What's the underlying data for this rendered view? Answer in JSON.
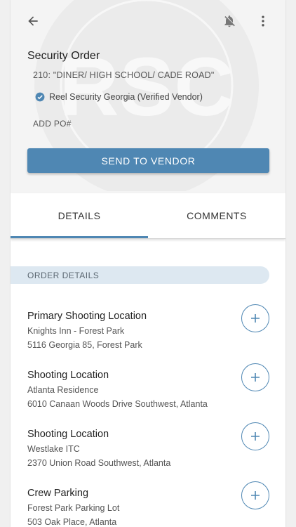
{
  "header": {
    "title": "Security Order",
    "subtitle": "210: \"DINER/ HIGH SCHOOL/ CADE ROAD\"",
    "vendor": "Reel Security Georgia (Verified Vendor)",
    "add_po": "ADD PO#",
    "send_button": "SEND TO VENDOR",
    "watermark_text": "RSC",
    "icons": {
      "back": "arrow-back-icon",
      "bell": "bell-off-icon",
      "more": "more-vertical-icon",
      "verified": "check-circle-icon"
    }
  },
  "tabs": [
    {
      "label": "DETAILS",
      "active": true
    },
    {
      "label": "COMMENTS",
      "active": false
    }
  ],
  "section": {
    "label": "ORDER DETAILS"
  },
  "locations": [
    {
      "name": "Primary Shooting Location",
      "place": "Knights Inn - Forest Park",
      "address": "5116 Georgia 85, Forest Park"
    },
    {
      "name": "Shooting Location",
      "place": "Atlanta Residence",
      "address": "6010 Canaan Woods Drive Southwest, Atlanta"
    },
    {
      "name": "Shooting Location",
      "place": "Westlake ITC",
      "address": "2370 Union Road Southwest, Atlanta"
    },
    {
      "name": "Crew Parking",
      "place": "Forest Park Parking Lot",
      "address": "503 Oak Place, Atlanta"
    }
  ],
  "colors": {
    "accent": "#4f87b3",
    "section_bg": "#dde8f1",
    "header_bg": "#f4f4f4"
  }
}
